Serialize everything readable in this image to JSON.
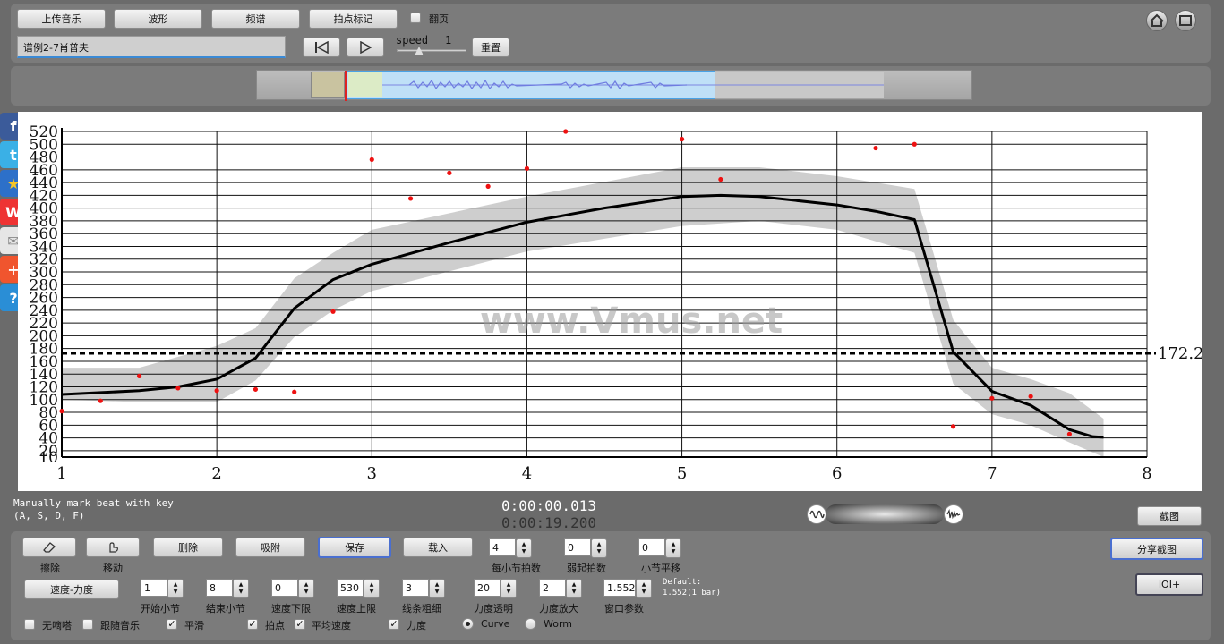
{
  "toolbar": {
    "upload_label": "上传音乐",
    "waveform_label": "波形",
    "spectrum_label": "频谱",
    "beat_mark_label": "拍点标记",
    "page_turn_label": "翻页",
    "song_title_value": "谱例2-7肖普夫",
    "speed_label": "speed",
    "speed_value": "1",
    "reset_label": "重置"
  },
  "chart_data": {
    "type": "line",
    "x_ticks": [
      "1",
      "2",
      "3",
      "4",
      "5",
      "6",
      "7",
      "8"
    ],
    "y_ticks": [
      "10",
      "20",
      "40",
      "60",
      "80",
      "100",
      "120",
      "140",
      "160",
      "180",
      "200",
      "220",
      "240",
      "260",
      "280",
      "300",
      "320",
      "340",
      "360",
      "380",
      "400",
      "420",
      "440",
      "460",
      "480",
      "500",
      "520"
    ],
    "xlim": [
      1,
      8
    ],
    "ylim": [
      10,
      520
    ],
    "watermark": "www.Vmus.net",
    "reference_label": "172.2",
    "reference_value": 172.2,
    "series": [
      {
        "type": "line",
        "values": [
          [
            1,
            108
          ],
          [
            1.5,
            114
          ],
          [
            1.75,
            120
          ],
          [
            2,
            132
          ],
          [
            2.25,
            165
          ],
          [
            2.5,
            243
          ],
          [
            2.75,
            288
          ],
          [
            3,
            312
          ],
          [
            3.5,
            346
          ],
          [
            4,
            378
          ],
          [
            4.5,
            400
          ],
          [
            5,
            418
          ],
          [
            5.25,
            420
          ],
          [
            5.5,
            418
          ],
          [
            6,
            405
          ],
          [
            6.25,
            395
          ],
          [
            6.5,
            382
          ],
          [
            6.75,
            175
          ],
          [
            7,
            113
          ],
          [
            7.25,
            91
          ],
          [
            7.5,
            53
          ],
          [
            7.65,
            42
          ],
          [
            7.72,
            41
          ]
        ]
      },
      {
        "type": "band",
        "values": [
          [
            1,
            100,
            150
          ],
          [
            1.5,
            96,
            150
          ],
          [
            2,
            96,
            184
          ],
          [
            2.25,
            130,
            212
          ],
          [
            2.5,
            198,
            290
          ],
          [
            2.75,
            240,
            330
          ],
          [
            3,
            270,
            366
          ],
          [
            4,
            332,
            418
          ],
          [
            5,
            372,
            464
          ],
          [
            5.5,
            380,
            464
          ],
          [
            6,
            366,
            450
          ],
          [
            6.5,
            330,
            430
          ],
          [
            6.75,
            125,
            225
          ],
          [
            7,
            77,
            150
          ],
          [
            7.25,
            60,
            132
          ],
          [
            7.5,
            33,
            110
          ],
          [
            7.72,
            10,
            70
          ]
        ]
      },
      {
        "type": "scatter",
        "values": [
          [
            1,
            82
          ],
          [
            1.25,
            98
          ],
          [
            1.5,
            137
          ],
          [
            1.75,
            118
          ],
          [
            2,
            114
          ],
          [
            2.25,
            116
          ],
          [
            2.5,
            112
          ],
          [
            2.75,
            238
          ],
          [
            3,
            476
          ],
          [
            3.25,
            415
          ],
          [
            3.5,
            455
          ],
          [
            3.75,
            434
          ],
          [
            4,
            462
          ],
          [
            4.25,
            520
          ],
          [
            5,
            508
          ],
          [
            5.25,
            445
          ],
          [
            6.25,
            494
          ],
          [
            6.5,
            500
          ],
          [
            6.75,
            58
          ],
          [
            7,
            102
          ],
          [
            7.25,
            105
          ],
          [
            7.5,
            46
          ]
        ]
      }
    ]
  },
  "status": {
    "hint_line1": "Manually mark beat with key",
    "hint_line2": "(A, S, D, F)",
    "time_current": "0:00:00.013",
    "time_total": "0:00:19.200",
    "screenshot_label": "截图"
  },
  "controls": {
    "erase_label": "擦除",
    "move_label": "移动",
    "delete_label": "删除",
    "snap_label": "吸附",
    "save_label": "保存",
    "load_label": "载入",
    "beats_per_bar": {
      "value": "4",
      "label": "每小节拍数"
    },
    "pickup_beats": {
      "value": "0",
      "label": "弱起拍数"
    },
    "bar_shift": {
      "value": "0",
      "label": "小节平移"
    },
    "share_label": "分享截图",
    "ioi_label": "IOI+",
    "tempo_dynamics_label": "速度-力度",
    "start_bar": {
      "value": "1",
      "label": "开始小节"
    },
    "end_bar": {
      "value": "8",
      "label": "结束小节"
    },
    "tempo_min": {
      "value": "0",
      "label": "速度下限"
    },
    "tempo_max": {
      "value": "530",
      "label": "速度上限"
    },
    "line_width": {
      "value": "3",
      "label": "线条粗细"
    },
    "dynamics_opacity": {
      "value": "20",
      "label": "力度透明"
    },
    "dynamics_zoom": {
      "value": "2",
      "label": "力度放大"
    },
    "window_param": {
      "value": "1.552",
      "label": "窗口参数"
    },
    "default_line1": "Default:",
    "default_line2": "1.552(1 bar)",
    "no_click_label": "无嘀嗒",
    "follow_music_label": "跟随音乐",
    "smooth_label": "平滑",
    "beats_label": "拍点",
    "avg_tempo_label": "平均速度",
    "dynamics_label": "力度",
    "curve_label": "Curve",
    "worm_label": "Worm"
  }
}
